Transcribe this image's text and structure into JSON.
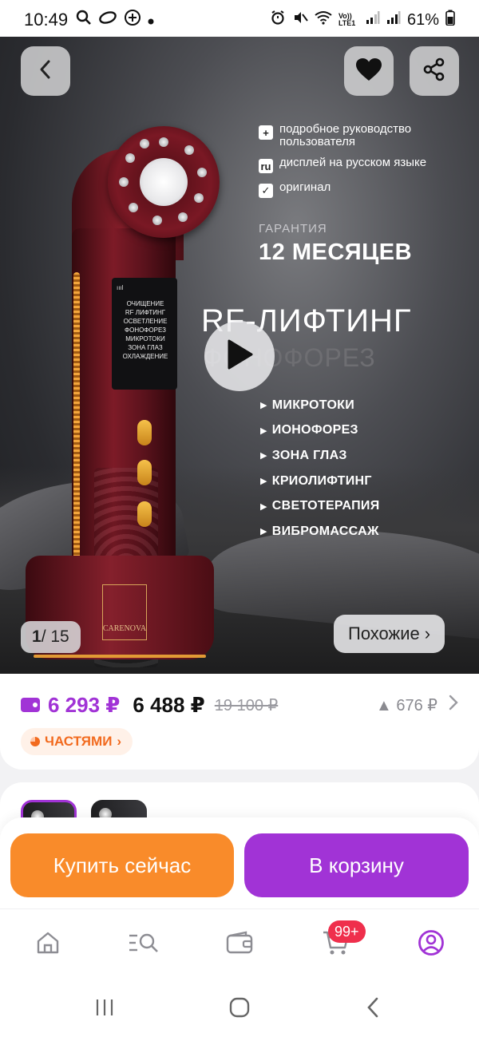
{
  "status_bar": {
    "time": "10:49",
    "battery": "61%",
    "network": "Vo)) LTE1"
  },
  "hero": {
    "features": [
      {
        "icon": "plus-icon",
        "icon_glyph": "+",
        "text": "подробное руководство пользователя"
      },
      {
        "icon": "ru-icon",
        "icon_glyph": "ru",
        "text": "дисплей на русском языке"
      },
      {
        "icon": "check-icon",
        "icon_glyph": "✓",
        "text": "оригинал"
      }
    ],
    "warranty_label": "ГАРАНТИЯ",
    "warranty_value": "12 МЕСЯЦЕВ",
    "headline": "RF-ЛИФТИНГ",
    "subheadline": "ФОНОФОРЕЗ",
    "functions": [
      "МИКРОТОКИ",
      "ИОНОФОРЕЗ",
      "ЗОНА ГЛАЗ",
      "КРИОЛИФТИНГ",
      "СВЕТОТЕРАПИЯ",
      "ВИБРОМАССАЖ"
    ],
    "device_screen": [
      "ОЧИЩЕНИЕ",
      "RF ЛИФТИНГ",
      "ОСВЕТЛЕНИЕ",
      "ФОНОФОРЕЗ",
      "МИКРОТОКИ",
      "ЗОНА ГЛАЗ",
      "ОХЛАЖДЕНИЕ"
    ],
    "device_brand": "CARENOVA",
    "counter_current": "1",
    "counter_total": "/ 15",
    "similar_label": "Похожие",
    "similar_chevron": "›"
  },
  "price": {
    "card_price": "6 293 ₽",
    "price": "6 488 ₽",
    "old_price": "19 100 ₽",
    "diff": "▲ 676 ₽",
    "installments": "ЧАСТЯМИ",
    "installments_chevron": "›"
  },
  "actions": {
    "buy_now": "Купить сейчас",
    "add_to_cart": "В корзину"
  },
  "bottom_nav": {
    "cart_badge": "99+"
  },
  "colors": {
    "accent_purple": "#a133d6",
    "accent_orange": "#f98b2a",
    "badge_red": "#ef2f4c"
  }
}
